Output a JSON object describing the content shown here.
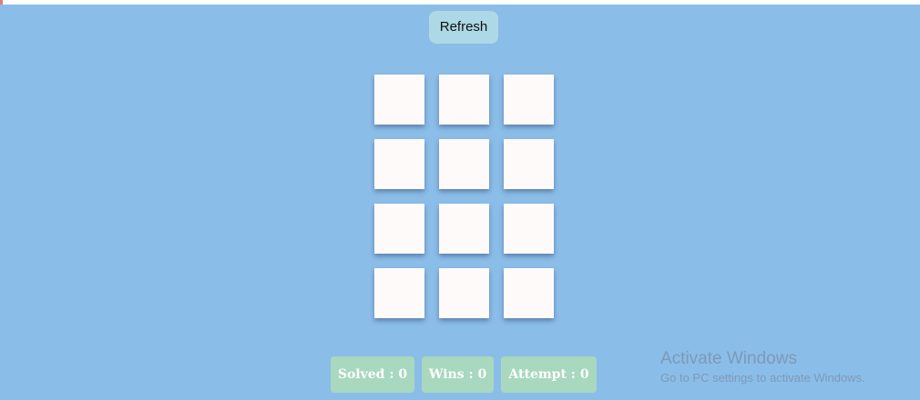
{
  "toolbar": {
    "refresh_label": "Refresh"
  },
  "board": {
    "rows": 4,
    "cols": 3,
    "tile_color": "#fffafa"
  },
  "stats": {
    "solved": "Solved : 0",
    "wins": "Wins : 0",
    "attempt": "Attempt : 0"
  },
  "watermark": {
    "title": "Activate Windows",
    "subtitle": "Go to PC settings to activate Windows."
  },
  "colors": {
    "background": "#8bbde9",
    "refresh_button": "#add8e6",
    "stat_badge": "#a8d8bd",
    "left_edge": "#e57a7a"
  }
}
